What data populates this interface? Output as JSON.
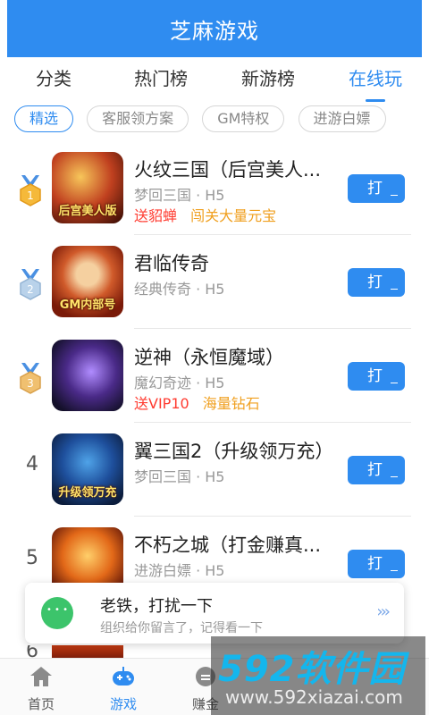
{
  "header": {
    "title": "芝麻游戏"
  },
  "tabs": [
    {
      "label": "分类",
      "active": false
    },
    {
      "label": "热门榜",
      "active": false
    },
    {
      "label": "新游榜",
      "active": false
    },
    {
      "label": "在线玩",
      "active": true
    }
  ],
  "chips": [
    {
      "label": "精选",
      "active": true
    },
    {
      "label": "客服领方案",
      "active": false
    },
    {
      "label": "GM特权",
      "active": false
    },
    {
      "label": "进游白嫖",
      "active": false
    }
  ],
  "games": [
    {
      "rank": "1",
      "medal": "gold-medal-icon",
      "name": "火纹三国（后宫美人...",
      "meta": "梦回三国 · H5",
      "tags": [
        "送貂蝉",
        "闯关大量元宝"
      ],
      "thumb_caption": "后宫美人版",
      "button": "打"
    },
    {
      "rank": "2",
      "medal": "silver-medal-icon",
      "name": "君临传奇",
      "meta": "经典传奇 · H5",
      "tags": [],
      "thumb_caption": "GM内部号",
      "button": "打"
    },
    {
      "rank": "3",
      "medal": "bronze-medal-icon",
      "name": "逆神（永恒魔域）",
      "meta": "魔幻奇迹 · H5",
      "tags": [
        "送VIP10",
        "海量钻石"
      ],
      "thumb_caption": "",
      "button": "打"
    },
    {
      "rank": "4",
      "medal": "",
      "name": "翼三国2（升级领万充）",
      "meta": "梦回三国 · H5",
      "tags": [],
      "thumb_caption": "升级领万充",
      "button": "打"
    },
    {
      "rank": "5",
      "medal": "",
      "name": "不朽之城（打金赚真...",
      "meta": "进游白嫖 · H5",
      "tags": [],
      "thumb_caption": "",
      "button": "打"
    }
  ],
  "partial_row": {
    "rank": "6"
  },
  "toast": {
    "title": "老铁，打扰一下",
    "subtitle": "组织给你留言了，记得看一下",
    "icon": "chat-bubble-icon"
  },
  "bottom_nav": [
    {
      "label": "首页",
      "icon": "home-icon",
      "active": false
    },
    {
      "label": "游戏",
      "icon": "gamepad-icon",
      "active": true
    },
    {
      "label": "赚金",
      "icon": "coin-icon",
      "active": false
    }
  ],
  "watermark": {
    "logo": "592软件园",
    "url": "www.592xiazai.com"
  },
  "colors": {
    "primary": "#2f8cf0",
    "red_tag": "#ff3b30",
    "orange_tag": "#f0a020",
    "toast_icon": "#3cc46b"
  }
}
